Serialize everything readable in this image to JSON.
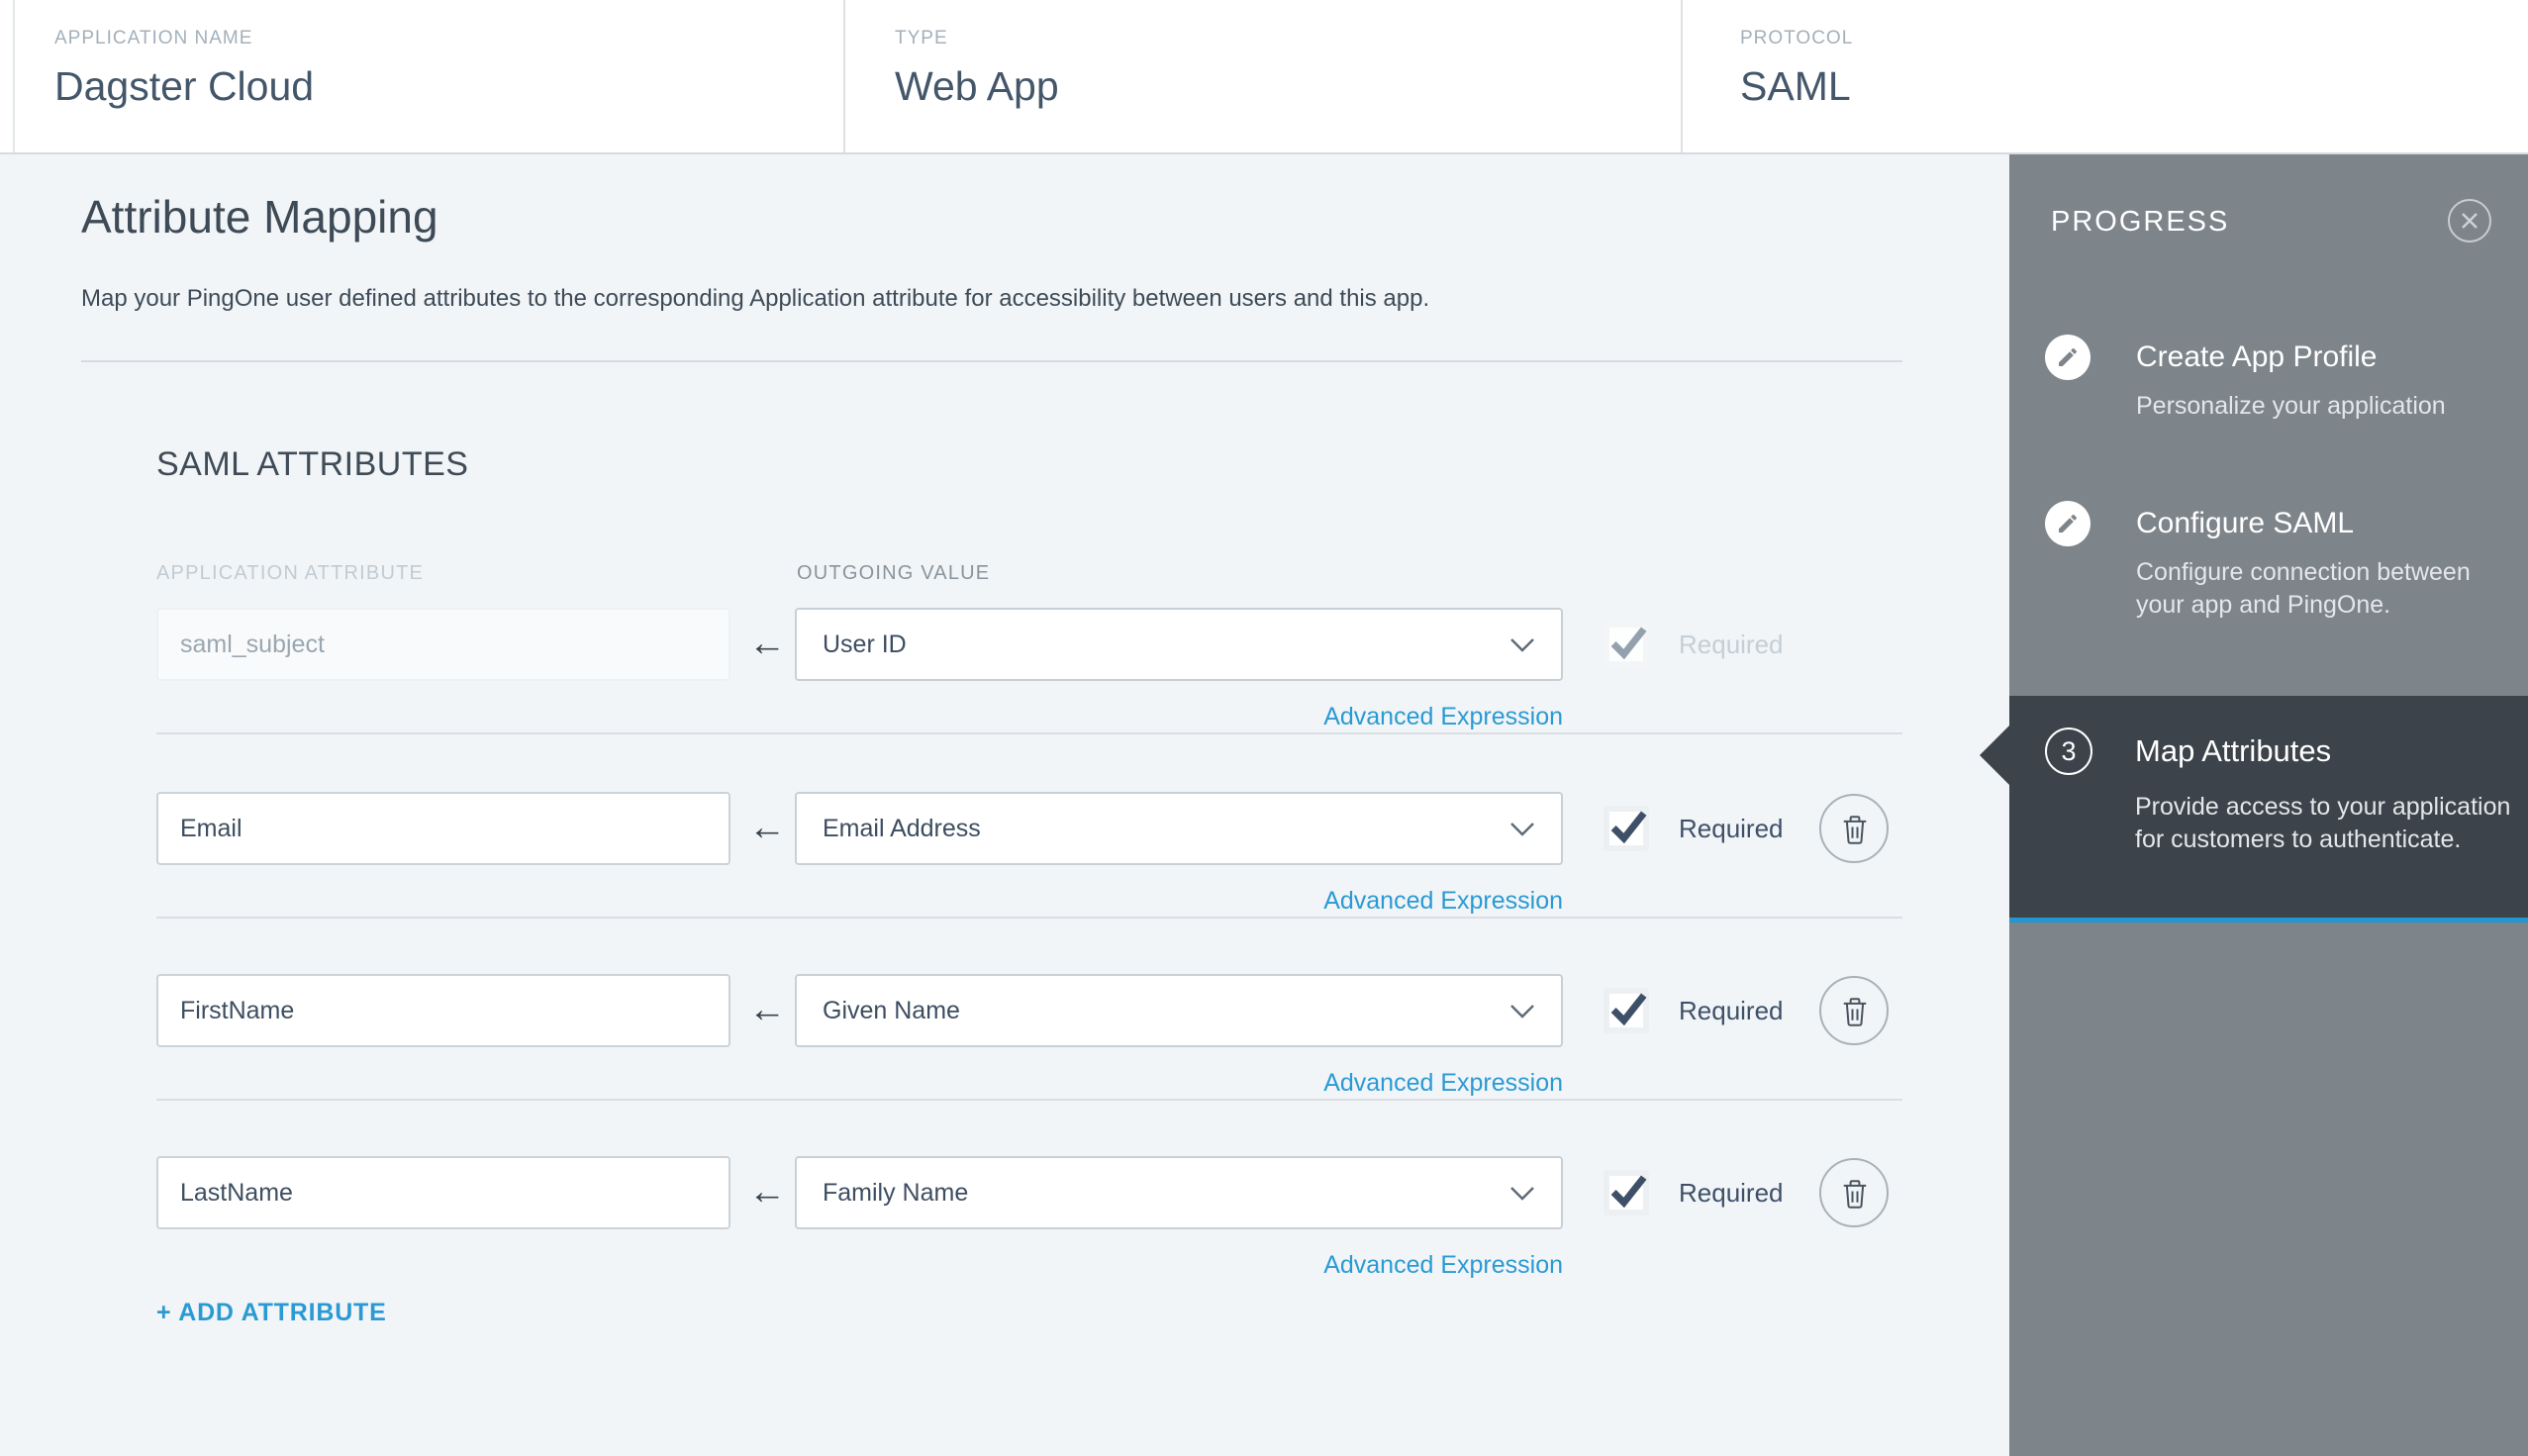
{
  "header": {
    "fields": [
      {
        "label": "APPLICATION NAME",
        "value": "Dagster Cloud"
      },
      {
        "label": "TYPE",
        "value": "Web App"
      },
      {
        "label": "PROTOCOL",
        "value": "SAML"
      }
    ]
  },
  "main": {
    "title": "Attribute Mapping",
    "description": "Map your PingOne user defined attributes to the corresponding Application attribute for accessibility between users and this app.",
    "section_title": "SAML ATTRIBUTES",
    "columns": {
      "application_attribute": "APPLICATION ATTRIBUTE",
      "outgoing_value": "OUTGOING VALUE"
    },
    "required_label": "Required",
    "advanced_expression_label": "Advanced Expression",
    "add_attribute_label": "+ ADD ATTRIBUTE",
    "glyphs": {
      "mapping_arrow": "←"
    },
    "rows": [
      {
        "application_attribute": "saml_subject",
        "outgoing_value": "User ID",
        "required": true,
        "disabled": true,
        "deletable": false
      },
      {
        "application_attribute": "Email",
        "outgoing_value": "Email Address",
        "required": true,
        "disabled": false,
        "deletable": true
      },
      {
        "application_attribute": "FirstName",
        "outgoing_value": "Given Name",
        "required": true,
        "disabled": false,
        "deletable": true
      },
      {
        "application_attribute": "LastName",
        "outgoing_value": "Family Name",
        "required": true,
        "disabled": false,
        "deletable": true
      }
    ]
  },
  "progress": {
    "title": "PROGRESS",
    "steps": [
      {
        "title": "Create App Profile",
        "description": "Personalize your application",
        "icon": "pencil",
        "active": false
      },
      {
        "title": "Configure SAML",
        "description": "Configure connection between your app and PingOne.",
        "icon": "pencil",
        "active": false
      },
      {
        "number": "3",
        "title": "Map Attributes",
        "description": "Provide access to your application for customers to authenticate.",
        "icon": "number-badge",
        "active": true
      }
    ]
  },
  "icons": {
    "close": "circle-x",
    "step_edit": "pencil",
    "delete_row": "trash",
    "select_open": "chevron-down",
    "mapping_direction": "arrow-left",
    "required_check": "check"
  },
  "colors": {
    "accent_blue": "#2b9ad3",
    "active_step_underline": "#2397cf",
    "sidebar_gray": "#7d848a",
    "active_step_bg": "#3c434a",
    "page_bg": "#f1f5f8",
    "text_dark": "#3e4a55",
    "text_navy": "#3e5068"
  }
}
